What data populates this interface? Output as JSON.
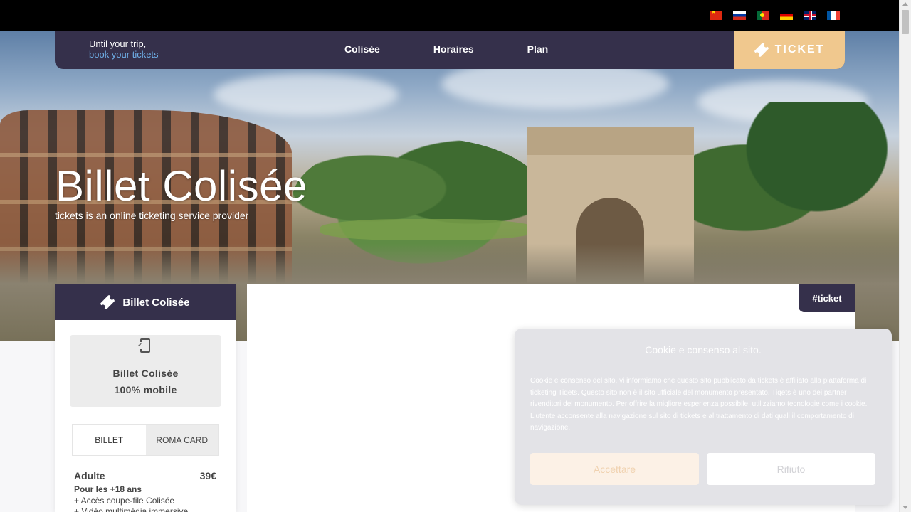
{
  "languages": [
    {
      "code": "cn",
      "icon": "flag-china-icon"
    },
    {
      "code": "ru",
      "icon": "flag-russia-icon"
    },
    {
      "code": "pt",
      "icon": "flag-portugal-icon"
    },
    {
      "code": "de",
      "icon": "flag-germany-icon"
    },
    {
      "code": "gb",
      "icon": "flag-uk-icon"
    },
    {
      "code": "fr",
      "icon": "flag-france-icon"
    }
  ],
  "navbar": {
    "brand_line1": "Until your trip,",
    "brand_line2": "book your tickets",
    "links": [
      "Colisée",
      "Horaires",
      "Plan"
    ],
    "ticket_label": "TICKET",
    "ticket_icon": "ticket-icon"
  },
  "hero": {
    "title": "Billet Colisée",
    "subtitle": "tickets is an online ticketing service provider"
  },
  "sidebar": {
    "header": "Billet Colisée",
    "header_icon": "ticket-icon",
    "mobile_icon": "mobile-phone-check-icon",
    "mobile_title": "Billet Colisée",
    "mobile_sub": "100% mobile",
    "tabs": [
      "BILLET",
      "ROMA CARD"
    ],
    "active_tab": "BILLET",
    "price": {
      "label": "Adulte",
      "amount": "39€",
      "note": "Pour les +18 ans",
      "features": [
        "+ Accès coupe-file Colisée",
        "+ Vidéo multimédia immersive"
      ]
    }
  },
  "main": {
    "hashtag": "#ticket"
  },
  "cookie": {
    "title": "Cookie e consenso al sito.",
    "body": "Cookie e consenso del sito, vi informiamo che questo sito pubblicato da tickets è affiliato alla piattaforma di ticketing Tiqets. Questo sito non è il sito ufficiale del monumento presentato. Tiqets è uno dei partner rivenditori del monumento. Per offrire la migliore esperienza possibile, utilizziamo tecnologie come i cookie. L'utente acconsente alla navigazione sul sito di tickets e al trattamento di dati quali il comportamento di navigazione.",
    "accept_label": "Accettare",
    "refuse_label": "Rifiuto"
  },
  "colors": {
    "navy": "#35304b",
    "accent": "#f0c88e",
    "brand_blue": "#6fb0e8"
  }
}
